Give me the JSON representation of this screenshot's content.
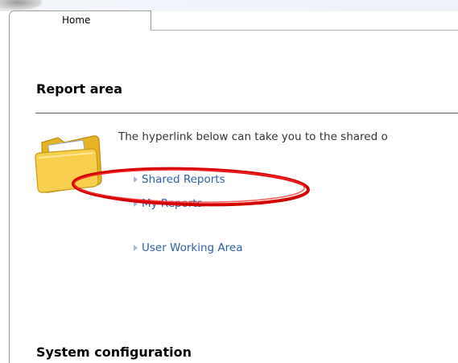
{
  "tabs": [
    {
      "label": "Home"
    }
  ],
  "report_area": {
    "title": "Report area",
    "intro": "The hyperlink below can take you to the shared o",
    "links": [
      {
        "label": "Shared Reports"
      },
      {
        "label": "My Reports"
      },
      {
        "label": "User Working Area"
      }
    ]
  },
  "system_configuration": {
    "title": "System configuration"
  },
  "icons": {
    "folder": "folder-icon",
    "bullet": "triangle-bullet-icon"
  },
  "colors": {
    "link": "#3060a8",
    "annotation": "#dd0000",
    "folder": "#f5c842"
  }
}
